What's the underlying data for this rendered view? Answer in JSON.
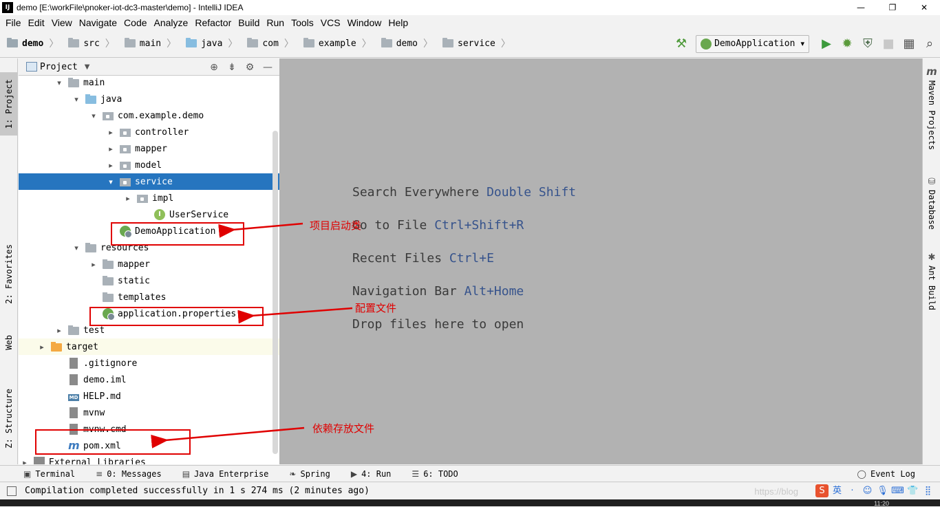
{
  "window": {
    "title": "demo [E:\\workFile\\pnoker-iot-dc3-master\\demo] - IntelliJ IDEA",
    "app_icon": "IJ",
    "controls": [
      "—",
      "❐",
      "✕"
    ]
  },
  "menu": [
    "File",
    "Edit",
    "View",
    "Navigate",
    "Code",
    "Analyze",
    "Refactor",
    "Build",
    "Run",
    "Tools",
    "VCS",
    "Window",
    "Help"
  ],
  "breadcrumbs": [
    "demo",
    "src",
    "main",
    "java",
    "com",
    "example",
    "demo",
    "service"
  ],
  "toolbar": {
    "run_config": "DemoApplication",
    "icons": [
      "hammer-icon",
      "run-icon",
      "debug-icon",
      "coverage-icon",
      "stop-icon",
      "project-structure-icon",
      "search-icon"
    ]
  },
  "left_tabs": {
    "project": "1: Project",
    "favorites": "2: Favorites",
    "web": "Web",
    "structure": "Z: Structure"
  },
  "right_tabs": {
    "maven": "Maven Projects",
    "database": "Database",
    "ant": "Ant Build"
  },
  "project_panel": {
    "title": "Project",
    "tree": [
      {
        "label": "main",
        "level": 2,
        "arrow": "▾",
        "icon": "folder"
      },
      {
        "label": "java",
        "level": 3,
        "arrow": "▾",
        "icon": "folder-blue"
      },
      {
        "label": "com.example.demo",
        "level": 4,
        "arrow": "▾",
        "icon": "package"
      },
      {
        "label": "controller",
        "level": 5,
        "arrow": "▸",
        "icon": "package"
      },
      {
        "label": "mapper",
        "level": 5,
        "arrow": "▸",
        "icon": "package"
      },
      {
        "label": "model",
        "level": 5,
        "arrow": "▸",
        "icon": "package"
      },
      {
        "label": "service",
        "level": 5,
        "arrow": "▾",
        "icon": "package",
        "selected": true
      },
      {
        "label": "impl",
        "level": 6,
        "arrow": "▸",
        "icon": "package"
      },
      {
        "label": "UserService",
        "level": 7,
        "arrow": "",
        "icon": "interface"
      },
      {
        "label": "DemoApplication",
        "level": 5,
        "arrow": "",
        "icon": "spring-class"
      },
      {
        "label": "resources",
        "level": 3,
        "arrow": "▾",
        "icon": "folder"
      },
      {
        "label": "mapper",
        "level": 4,
        "arrow": "▸",
        "icon": "folder"
      },
      {
        "label": "static",
        "level": 4,
        "arrow": "",
        "icon": "folder"
      },
      {
        "label": "templates",
        "level": 4,
        "arrow": "",
        "icon": "folder"
      },
      {
        "label": "application.properties",
        "level": 4,
        "arrow": "",
        "icon": "spring-file"
      },
      {
        "label": "test",
        "level": 2,
        "arrow": "▸",
        "icon": "folder"
      },
      {
        "label": "target",
        "level": 1,
        "arrow": "▸",
        "icon": "folder-orange",
        "excluded": true
      },
      {
        "label": ".gitignore",
        "level": 2,
        "arrow": "",
        "icon": "file"
      },
      {
        "label": "demo.iml",
        "level": 2,
        "arrow": "",
        "icon": "file"
      },
      {
        "label": "HELP.md",
        "level": 2,
        "arrow": "",
        "icon": "md"
      },
      {
        "label": "mvnw",
        "level": 2,
        "arrow": "",
        "icon": "file"
      },
      {
        "label": "mvnw.cmd",
        "level": 2,
        "arrow": "",
        "icon": "file"
      },
      {
        "label": "pom.xml",
        "level": 2,
        "arrow": "",
        "icon": "maven"
      },
      {
        "label": "External Libraries",
        "level": 0,
        "arrow": "▸",
        "icon": "library"
      }
    ]
  },
  "editor": {
    "hints": [
      {
        "text": "Search Everywhere ",
        "key": "Double Shift"
      },
      {
        "text": "Go to File ",
        "key": "Ctrl+Shift+R"
      },
      {
        "text": "Recent Files ",
        "key": "Ctrl+E"
      },
      {
        "text": "Navigation Bar ",
        "key": "Alt+Home"
      },
      {
        "text": "Drop files here to open",
        "key": ""
      }
    ]
  },
  "bottom_tabs": [
    {
      "label": "Terminal",
      "icon": "terminal-icon",
      "glyph": "▣"
    },
    {
      "label": "0: Messages",
      "icon": "messages-icon",
      "glyph": "≡"
    },
    {
      "label": "Java Enterprise",
      "icon": "java-enterprise-icon",
      "glyph": "▤"
    },
    {
      "label": "Spring",
      "icon": "spring-icon",
      "glyph": "❧"
    },
    {
      "label": "4: Run",
      "icon": "run-icon",
      "glyph": "▶"
    },
    {
      "label": "6: TODO",
      "icon": "todo-icon",
      "glyph": "☰"
    }
  ],
  "event_log": "Event Log",
  "status": {
    "message": "Compilation completed successfully in 1 s 274 ms (2 minutes ago)",
    "watermark": "https://blog",
    "tray": [
      "S",
      "英",
      "·",
      "☺",
      "🎙",
      "⌨",
      "👕",
      "⣿"
    ],
    "time": "11:20"
  },
  "annotations": [
    {
      "text": "项目启动类",
      "color": "#e00000"
    },
    {
      "text": "配置文件",
      "color": "#e00000"
    },
    {
      "text": "依赖存放文件",
      "color": "#e00000"
    }
  ]
}
